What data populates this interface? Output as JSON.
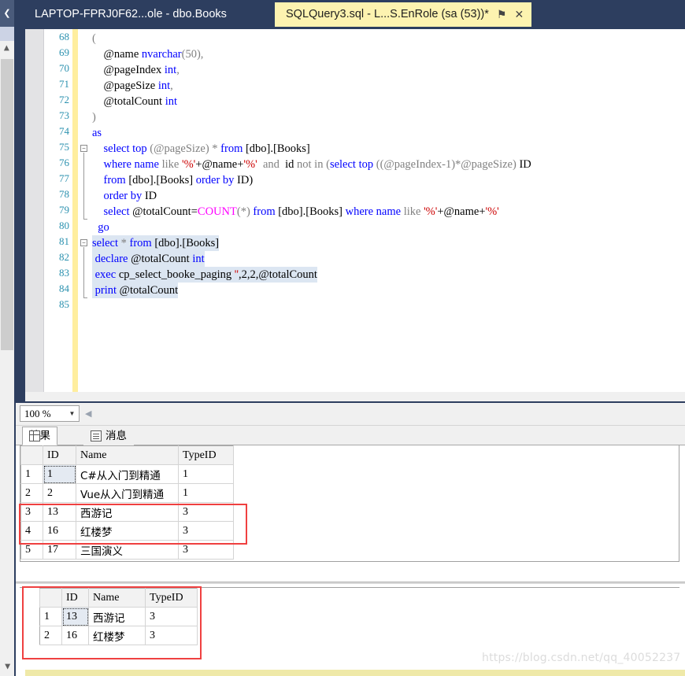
{
  "window": {
    "dock_tab_icon": "❮",
    "tabs": [
      {
        "label": "LAPTOP-FPRJ0F62...ole - dbo.Books",
        "active": false
      },
      {
        "label": "SQLQuery3.sql - L...S.EnRole (sa (53))*",
        "active": true
      }
    ],
    "tab_pin_icon": "⚑",
    "tab_close_icon": "✕"
  },
  "editor": {
    "first_line_number": 68,
    "lines": [
      {
        "n": 68,
        "selected": false,
        "tokens": [
          {
            "t": "(",
            "c": "gray"
          }
        ]
      },
      {
        "n": 69,
        "selected": false,
        "tokens": [
          {
            "t": "    @name ",
            "c": "id"
          },
          {
            "t": "nvarchar",
            "c": "typ"
          },
          {
            "t": "(50),",
            "c": "gray"
          }
        ]
      },
      {
        "n": 70,
        "selected": false,
        "tokens": [
          {
            "t": "    @pageIndex ",
            "c": "id"
          },
          {
            "t": "int",
            "c": "typ"
          },
          {
            "t": ",",
            "c": "gray"
          }
        ]
      },
      {
        "n": 71,
        "selected": false,
        "tokens": [
          {
            "t": "    @pageSize ",
            "c": "id"
          },
          {
            "t": "int",
            "c": "typ"
          },
          {
            "t": ",",
            "c": "gray"
          }
        ]
      },
      {
        "n": 72,
        "selected": false,
        "tokens": [
          {
            "t": "    @totalCount ",
            "c": "id"
          },
          {
            "t": "int",
            "c": "typ"
          }
        ]
      },
      {
        "n": 73,
        "selected": false,
        "tokens": [
          {
            "t": ")",
            "c": "gray"
          }
        ]
      },
      {
        "n": 74,
        "selected": false,
        "tokens": [
          {
            "t": "as",
            "c": "kw"
          }
        ]
      },
      {
        "n": 75,
        "selected": false,
        "tokens": [
          {
            "t": "    ",
            "c": "id"
          },
          {
            "t": "select top ",
            "c": "kw"
          },
          {
            "t": "(@pageSize) ",
            "c": "gray"
          },
          {
            "t": "* ",
            "c": "gray"
          },
          {
            "t": "from ",
            "c": "kw"
          },
          {
            "t": "[dbo].[Books]",
            "c": "id"
          }
        ]
      },
      {
        "n": 76,
        "selected": false,
        "tokens": [
          {
            "t": "    ",
            "c": "id"
          },
          {
            "t": "where name ",
            "c": "kw"
          },
          {
            "t": "like ",
            "c": "gray"
          },
          {
            "t": "'%'",
            "c": "str"
          },
          {
            "t": "+@name+",
            "c": "id"
          },
          {
            "t": "'%'",
            "c": "str"
          },
          {
            "t": "  and  ",
            "c": "gray"
          },
          {
            "t": "id ",
            "c": "id"
          },
          {
            "t": "not in ",
            "c": "gray"
          },
          {
            "t": "(",
            "c": "gray"
          },
          {
            "t": "select top ",
            "c": "kw"
          },
          {
            "t": "((@pageIndex-1)*@pageSize) ",
            "c": "gray"
          },
          {
            "t": "ID",
            "c": "id"
          }
        ]
      },
      {
        "n": 77,
        "selected": false,
        "tokens": [
          {
            "t": "    ",
            "c": "id"
          },
          {
            "t": "from ",
            "c": "kw"
          },
          {
            "t": "[dbo].[Books] ",
            "c": "id"
          },
          {
            "t": "order by ",
            "c": "kw"
          },
          {
            "t": "ID)",
            "c": "id"
          }
        ]
      },
      {
        "n": 78,
        "selected": false,
        "tokens": [
          {
            "t": "    ",
            "c": "id"
          },
          {
            "t": "order by ",
            "c": "kw"
          },
          {
            "t": "ID",
            "c": "id"
          }
        ]
      },
      {
        "n": 79,
        "selected": false,
        "tokens": [
          {
            "t": "    ",
            "c": "id"
          },
          {
            "t": "select ",
            "c": "kw"
          },
          {
            "t": "@totalCount=",
            "c": "id"
          },
          {
            "t": "COUNT",
            "c": "fn"
          },
          {
            "t": "(*) ",
            "c": "gray"
          },
          {
            "t": "from ",
            "c": "kw"
          },
          {
            "t": "[dbo].[Books] ",
            "c": "id"
          },
          {
            "t": "where name ",
            "c": "kw"
          },
          {
            "t": "like ",
            "c": "gray"
          },
          {
            "t": "'%'",
            "c": "str"
          },
          {
            "t": "+@name+",
            "c": "id"
          },
          {
            "t": "'%'",
            "c": "str"
          }
        ]
      },
      {
        "n": 80,
        "selected": false,
        "tokens": [
          {
            "t": "  go",
            "c": "kw"
          }
        ]
      },
      {
        "n": 81,
        "selected": true,
        "tokens": [
          {
            "t": "select ",
            "c": "kw"
          },
          {
            "t": "* ",
            "c": "gray"
          },
          {
            "t": "from ",
            "c": "kw"
          },
          {
            "t": "[dbo].[Books]",
            "c": "id"
          }
        ]
      },
      {
        "n": 82,
        "selected": true,
        "tokens": [
          {
            "t": " declare ",
            "c": "kw"
          },
          {
            "t": "@totalCount ",
            "c": "id"
          },
          {
            "t": "int",
            "c": "typ"
          }
        ]
      },
      {
        "n": 83,
        "selected": true,
        "tokens": [
          {
            "t": " exec ",
            "c": "kw"
          },
          {
            "t": "cp_select_booke_paging ",
            "c": "id"
          },
          {
            "t": "''",
            "c": "str"
          },
          {
            "t": ",2,2,@totalCount",
            "c": "id"
          }
        ]
      },
      {
        "n": 84,
        "selected": true,
        "tokens": [
          {
            "t": " print ",
            "c": "kw"
          },
          {
            "t": "@totalCount",
            "c": "id"
          }
        ]
      },
      {
        "n": 85,
        "selected": false,
        "tokens": []
      }
    ]
  },
  "results": {
    "zoom_value": "100 %",
    "zoom_arrow_icon": "▼",
    "nav_icon": "◀",
    "tabs": [
      {
        "label": "结果",
        "icon": "grid-icon",
        "active": true
      },
      {
        "label": "消息",
        "icon": "messages-icon",
        "active": false
      }
    ],
    "grid1": {
      "headers": [
        "",
        "ID",
        "Name",
        "TypeID"
      ],
      "rows": [
        {
          "n": "1",
          "id": "1",
          "name": "C#从入门到精通",
          "typeid": "1",
          "highlighted": false
        },
        {
          "n": "2",
          "id": "2",
          "name": "Vue从入门到精通",
          "typeid": "1",
          "highlighted": false
        },
        {
          "n": "3",
          "id": "13",
          "name": "西游记",
          "typeid": "3",
          "highlighted": true
        },
        {
          "n": "4",
          "id": "16",
          "name": "红楼梦",
          "typeid": "3",
          "highlighted": true
        },
        {
          "n": "5",
          "id": "17",
          "name": "三国演义",
          "typeid": "3",
          "highlighted": false
        }
      ]
    },
    "grid2": {
      "headers": [
        "",
        "ID",
        "Name",
        "TypeID"
      ],
      "rows": [
        {
          "n": "1",
          "id": "13",
          "name": "西游记",
          "typeid": "3"
        },
        {
          "n": "2",
          "id": "16",
          "name": "红楼梦",
          "typeid": "3"
        }
      ]
    }
  },
  "watermark": {
    "text": "https://blog.csdn.net/qq_40052237"
  },
  "colors": {
    "chrome": "#2d3e5f",
    "active_tab": "#fdf3b0",
    "keyword": "#0000ff",
    "string": "#cc0000",
    "function": "#ff00ff",
    "linenumber": "#2b91af",
    "highlight_box": "#ef4040",
    "selection": "#dce6f2"
  }
}
